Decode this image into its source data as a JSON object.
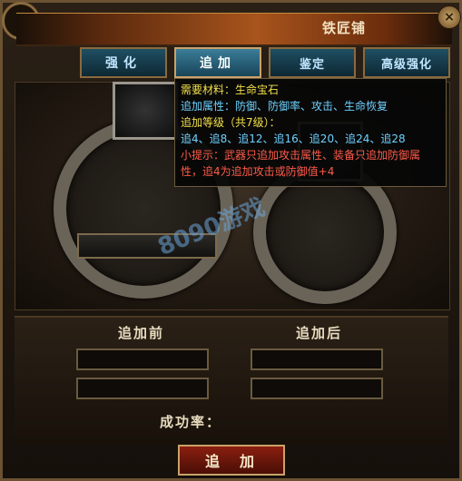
{
  "window": {
    "title": "铁匠铺",
    "close_glyph": "×"
  },
  "tabs": [
    {
      "label": "强化",
      "active": false
    },
    {
      "label": "追加",
      "active": true
    },
    {
      "label": "鉴定",
      "active": false
    },
    {
      "label": "高级强化",
      "active": false
    }
  ],
  "tooltip": {
    "material_label": "需要材料：",
    "material_value": "生命宝石",
    "attr_label": "追加属性：",
    "attr_value": "防御、防御率、攻击、生命恢复",
    "level_line": "追加等级（共7级）：",
    "levels": "追4、追8、追12、追16、追20、追24、追28",
    "hint_line1": "小提示：武器只追加攻击属性、装备只追加防御属",
    "hint_line2": "性，追4为追加攻击或防御值+4"
  },
  "watermark": "8090游戏",
  "compare": {
    "before_label": "追加前",
    "after_label": "追加后"
  },
  "success_rate": {
    "label": "成功率：",
    "value": ""
  },
  "action_button": {
    "label": "追加"
  },
  "colors": {
    "accent_gold": "#c9a26a",
    "tab_active": "#3b7d98",
    "tip_yellow": "#f2e04a",
    "tip_cyan": "#6fd1ff",
    "tip_red": "#ff5b4a",
    "button_red": "#8a1f10"
  }
}
